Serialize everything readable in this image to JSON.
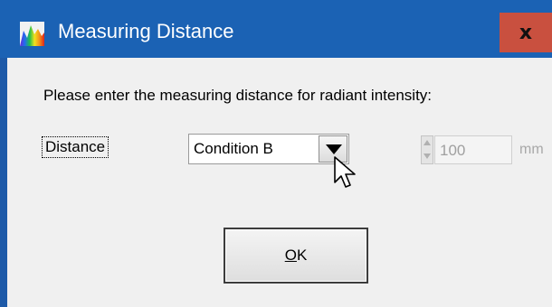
{
  "window": {
    "title": "Measuring Distance",
    "close_label": "x"
  },
  "dialog": {
    "prompt": "Please enter the measuring distance for radiant intensity:",
    "distance_label": "Distance",
    "condition_select": {
      "value": "Condition B"
    },
    "distance_spinner": {
      "value": "100",
      "enabled": false
    },
    "unit": "mm",
    "ok_button": {
      "mnemonic": "O",
      "rest": "K"
    }
  },
  "colors": {
    "titlebar": "#1b62b4",
    "close_button": "#c9503f",
    "client_background": "#f0f0f0"
  }
}
